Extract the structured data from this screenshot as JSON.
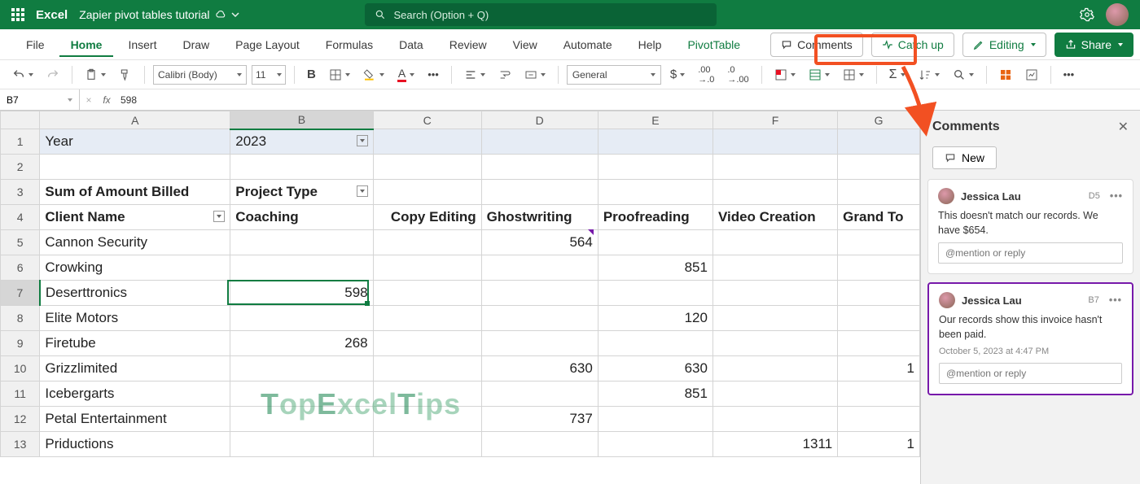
{
  "titlebar": {
    "appname": "Excel",
    "filename": "Zapier pivot tables tutorial",
    "search_placeholder": "Search (Option + Q)"
  },
  "tabs": {
    "file": "File",
    "home": "Home",
    "insert": "Insert",
    "draw": "Draw",
    "pagelayout": "Page Layout",
    "formulas": "Formulas",
    "data": "Data",
    "review": "Review",
    "view": "View",
    "automate": "Automate",
    "help": "Help",
    "pivottable": "PivotTable"
  },
  "rightbuttons": {
    "comments": "Comments",
    "catchup": "Catch up",
    "editing": "Editing",
    "share": "Share"
  },
  "toolbar": {
    "font": "Calibri (Body)",
    "size": "11",
    "numfmt": "General"
  },
  "fx": {
    "namebox": "B7",
    "value": "598"
  },
  "columns": [
    "A",
    "B",
    "C",
    "D",
    "E",
    "F",
    "G"
  ],
  "rows": {
    "1": {
      "A": "Year",
      "B": "2023"
    },
    "2": {},
    "3": {
      "A": "Sum of Amount Billed",
      "B": "Project Type"
    },
    "4": {
      "A": "Client Name",
      "B": "Coaching",
      "C": "Copy Editing",
      "D": "Ghostwriting",
      "E": "Proofreading",
      "F": "Video Creation",
      "G": "Grand To"
    },
    "5": {
      "A": "Cannon Security",
      "D": "564"
    },
    "6": {
      "A": "Crowking",
      "E": "851"
    },
    "7": {
      "A": "Deserttronics",
      "B": "598"
    },
    "8": {
      "A": "Elite Motors",
      "E": "120"
    },
    "9": {
      "A": "Firetube",
      "B": "268"
    },
    "10": {
      "A": "Grizzlimited",
      "D": "630",
      "E": "630",
      "G": "1"
    },
    "11": {
      "A": "Icebergarts",
      "E": "851"
    },
    "12": {
      "A": "Petal Entertainment",
      "D": "737"
    },
    "13": {
      "A": "Priductions",
      "F": "1311",
      "G": "1"
    }
  },
  "comments_panel": {
    "title": "Comments",
    "newbtn": "New",
    "cards": [
      {
        "author": "Jessica Lau",
        "ref": "D5",
        "body": "This doesn't match our records. We have $654.",
        "reply_placeholder": "@mention or reply"
      },
      {
        "author": "Jessica Lau",
        "ref": "B7",
        "body": "Our records show this invoice hasn't been paid.",
        "time": "October 5, 2023 at 4:47 PM",
        "reply_placeholder": "@mention or reply"
      }
    ]
  },
  "watermark": "TopExcelTips"
}
